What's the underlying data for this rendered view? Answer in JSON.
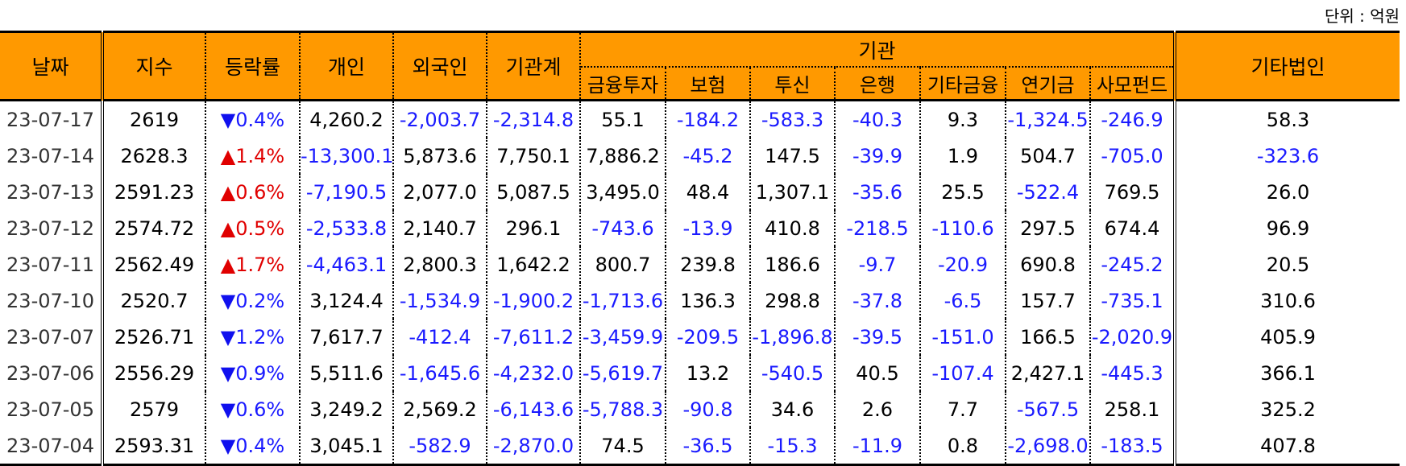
{
  "unit_label": "단위 : 억원",
  "headers": {
    "date": "날짜",
    "index": "지수",
    "change": "등락률",
    "individual": "개인",
    "foreign": "외국인",
    "institution_total": "기관계",
    "institution": "기관",
    "financial_investment": "금융투자",
    "insurance": "보험",
    "investment_trust": "투신",
    "bank": "은행",
    "other_finance": "기타금융",
    "pension": "연기금",
    "private_fund": "사모펀드",
    "other_corp": "기타법인"
  },
  "colors": {
    "header_bg": "#FF9900",
    "up": "#e00000",
    "down": "#1010ee",
    "negative": "#1a1aff"
  },
  "rows": [
    {
      "date": "23-07-17",
      "index": "2619",
      "dir": "down",
      "arrow": "▼",
      "change": "0.4%",
      "individual": "4,260.2",
      "foreign": "-2,003.7",
      "institution_total": "-2,314.8",
      "financial_investment": "55.1",
      "insurance": "-184.2",
      "investment_trust": "-583.3",
      "bank": "-40.3",
      "other_finance": "9.3",
      "pension": "-1,324.5",
      "private_fund": "-246.9",
      "other_corp": "58.3"
    },
    {
      "date": "23-07-14",
      "index": "2628.3",
      "dir": "up",
      "arrow": "▲",
      "change": "1.4%",
      "individual": "-13,300.1",
      "foreign": "5,873.6",
      "institution_total": "7,750.1",
      "financial_investment": "7,886.2",
      "insurance": "-45.2",
      "investment_trust": "147.5",
      "bank": "-39.9",
      "other_finance": "1.9",
      "pension": "504.7",
      "private_fund": "-705.0",
      "other_corp": "-323.6"
    },
    {
      "date": "23-07-13",
      "index": "2591.23",
      "dir": "up",
      "arrow": "▲",
      "change": "0.6%",
      "individual": "-7,190.5",
      "foreign": "2,077.0",
      "institution_total": "5,087.5",
      "financial_investment": "3,495.0",
      "insurance": "48.4",
      "investment_trust": "1,307.1",
      "bank": "-35.6",
      "other_finance": "25.5",
      "pension": "-522.4",
      "private_fund": "769.5",
      "other_corp": "26.0"
    },
    {
      "date": "23-07-12",
      "index": "2574.72",
      "dir": "up",
      "arrow": "▲",
      "change": "0.5%",
      "individual": "-2,533.8",
      "foreign": "2,140.7",
      "institution_total": "296.1",
      "financial_investment": "-743.6",
      "insurance": "-13.9",
      "investment_trust": "410.8",
      "bank": "-218.5",
      "other_finance": "-110.6",
      "pension": "297.5",
      "private_fund": "674.4",
      "other_corp": "96.9"
    },
    {
      "date": "23-07-11",
      "index": "2562.49",
      "dir": "up",
      "arrow": "▲",
      "change": "1.7%",
      "individual": "-4,463.1",
      "foreign": "2,800.3",
      "institution_total": "1,642.2",
      "financial_investment": "800.7",
      "insurance": "239.8",
      "investment_trust": "186.6",
      "bank": "-9.7",
      "other_finance": "-20.9",
      "pension": "690.8",
      "private_fund": "-245.2",
      "other_corp": "20.5"
    },
    {
      "date": "23-07-10",
      "index": "2520.7",
      "dir": "down",
      "arrow": "▼",
      "change": "0.2%",
      "individual": "3,124.4",
      "foreign": "-1,534.9",
      "institution_total": "-1,900.2",
      "financial_investment": "-1,713.6",
      "insurance": "136.3",
      "investment_trust": "298.8",
      "bank": "-37.8",
      "other_finance": "-6.5",
      "pension": "157.7",
      "private_fund": "-735.1",
      "other_corp": "310.6"
    },
    {
      "date": "23-07-07",
      "index": "2526.71",
      "dir": "down",
      "arrow": "▼",
      "change": "1.2%",
      "individual": "7,617.7",
      "foreign": "-412.4",
      "institution_total": "-7,611.2",
      "financial_investment": "-3,459.9",
      "insurance": "-209.5",
      "investment_trust": "-1,896.8",
      "bank": "-39.5",
      "other_finance": "-151.0",
      "pension": "166.5",
      "private_fund": "-2,020.9",
      "other_corp": "405.9"
    },
    {
      "date": "23-07-06",
      "index": "2556.29",
      "dir": "down",
      "arrow": "▼",
      "change": "0.9%",
      "individual": "5,511.6",
      "foreign": "-1,645.6",
      "institution_total": "-4,232.0",
      "financial_investment": "-5,619.7",
      "insurance": "13.2",
      "investment_trust": "-540.5",
      "bank": "40.5",
      "other_finance": "-107.4",
      "pension": "2,427.1",
      "private_fund": "-445.3",
      "other_corp": "366.1"
    },
    {
      "date": "23-07-05",
      "index": "2579",
      "dir": "down",
      "arrow": "▼",
      "change": "0.6%",
      "individual": "3,249.2",
      "foreign": "2,569.2",
      "institution_total": "-6,143.6",
      "financial_investment": "-5,788.3",
      "insurance": "-90.8",
      "investment_trust": "34.6",
      "bank": "2.6",
      "other_finance": "7.7",
      "pension": "-567.5",
      "private_fund": "258.1",
      "other_corp": "325.2"
    },
    {
      "date": "23-07-04",
      "index": "2593.31",
      "dir": "down",
      "arrow": "▼",
      "change": "0.4%",
      "individual": "3,045.1",
      "foreign": "-582.9",
      "institution_total": "-2,870.0",
      "financial_investment": "74.5",
      "insurance": "-36.5",
      "investment_trust": "-15.3",
      "bank": "-11.9",
      "other_finance": "0.8",
      "pension": "-2,698.0",
      "private_fund": "-183.5",
      "other_corp": "407.8"
    }
  ]
}
